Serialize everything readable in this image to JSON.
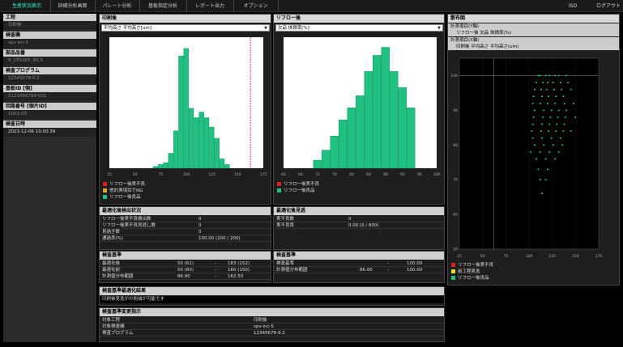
{
  "nav": {
    "tabs": [
      "生産状況表示",
      "詳細分析画面",
      "パレート分析",
      "基板指定分析",
      "レポート出力",
      "オプション"
    ],
    "active_index": 0,
    "user": "ISD",
    "logout": "ログアウト"
  },
  "sidebar": {
    "fields": [
      {
        "label": "工程",
        "value": "印刷後"
      },
      {
        "label": "検査機",
        "value": "spv-inc-5"
      },
      {
        "label": "部品品番",
        "value": "R_CP1005_R0.5"
      },
      {
        "label": "検査プログラム",
        "value": "12345678-9.2"
      },
      {
        "label": "基板ID [個]",
        "value": "0123456789-001"
      },
      {
        "label": "回路番号 [個片ID]",
        "value": "1001-03"
      },
      {
        "label": "検査日時",
        "value": "2023-12-06 10:00:39"
      }
    ]
  },
  "panel_print": {
    "title": "印刷後",
    "dropdown": "平均高さ 平均高さ[um]",
    "legend": [
      "リフロー後実不良",
      "他計測項目でNG",
      "リフロー後良品"
    ],
    "legend_colors": [
      "#e02020",
      "#e0a020",
      "#20c080"
    ],
    "chart_data": {
      "type": "bar",
      "x": [
        70,
        75,
        80,
        85,
        90,
        95,
        100,
        105,
        110,
        115,
        120,
        125,
        130,
        135,
        140
      ],
      "values": [
        1,
        2,
        3,
        8,
        20,
        60,
        64,
        32,
        27,
        30,
        27,
        22,
        16,
        5,
        2
      ],
      "xticks": [
        "25",
        "50",
        "75",
        "100",
        "125",
        "150",
        "175"
      ],
      "xlim": [
        25,
        175
      ],
      "ylim": [
        0,
        70
      ],
      "limit_line": 162.5
    }
  },
  "panel_reflow": {
    "title": "リフロー後",
    "dropdown": "欠品 体積率[%]",
    "legend": [
      "リフロー後実不良",
      "リフロー後良品"
    ],
    "legend_colors": [
      "#e02020",
      "#20c080"
    ],
    "chart_data": {
      "type": "bar",
      "x": [
        72,
        74,
        76,
        78,
        80,
        82,
        84,
        86,
        88,
        90,
        92,
        94
      ],
      "values": [
        4,
        9,
        16,
        24,
        30,
        36,
        48,
        56,
        60,
        48,
        40,
        30
      ],
      "xticks": [
        "64",
        "68",
        "72",
        "76",
        "80",
        "84",
        "88",
        "92",
        "96",
        "100"
      ],
      "xlim": [
        64,
        100
      ],
      "ylim": [
        0,
        65
      ]
    }
  },
  "scatter_panel": {
    "title": "散布図",
    "y_item_label": "計測項目(Y軸)",
    "y_item_value": "リフロー後 欠品 体積率(%)",
    "x_item_label": "計測項目(X軸)",
    "x_item_value": "印刷後 平均高さ 平均高さ(um)",
    "legend": [
      "リフロー後実不良",
      "前工程見逃",
      "リフロー後良品"
    ],
    "legend_colors": [
      "#e02020",
      "#e0e020",
      "#20c080"
    ],
    "chart_data": {
      "type": "scatter",
      "xticks": [
        "25",
        "50",
        "75",
        "100",
        "125",
        "150",
        "175"
      ],
      "yticks": [
        "50",
        "60",
        "70",
        "80",
        "90",
        "100"
      ],
      "xlim": [
        25,
        175
      ],
      "ylim": [
        50,
        105
      ],
      "points": [
        [
          110,
          100
        ],
        [
          112,
          100
        ],
        [
          118,
          100
        ],
        [
          122,
          100
        ],
        [
          128,
          100
        ],
        [
          132,
          100
        ],
        [
          140,
          100
        ],
        [
          108,
          98
        ],
        [
          115,
          98
        ],
        [
          120,
          98
        ],
        [
          126,
          98
        ],
        [
          134,
          98
        ],
        [
          142,
          98
        ],
        [
          106,
          96
        ],
        [
          113,
          96
        ],
        [
          119,
          96
        ],
        [
          127,
          96
        ],
        [
          135,
          96
        ],
        [
          145,
          96
        ],
        [
          105,
          94
        ],
        [
          114,
          94
        ],
        [
          121,
          94
        ],
        [
          129,
          94
        ],
        [
          137,
          94
        ],
        [
          104,
          92
        ],
        [
          112,
          92
        ],
        [
          120,
          92
        ],
        [
          128,
          92
        ],
        [
          138,
          92
        ],
        [
          148,
          92
        ],
        [
          106,
          90
        ],
        [
          116,
          90
        ],
        [
          124,
          90
        ],
        [
          132,
          90
        ],
        [
          140,
          90
        ],
        [
          105,
          88
        ],
        [
          115,
          88
        ],
        [
          123,
          88
        ],
        [
          131,
          88
        ],
        [
          139,
          88
        ],
        [
          150,
          88
        ],
        [
          104,
          86
        ],
        [
          114,
          86
        ],
        [
          122,
          86
        ],
        [
          130,
          86
        ],
        [
          138,
          86
        ],
        [
          103,
          84
        ],
        [
          113,
          84
        ],
        [
          121,
          84
        ],
        [
          129,
          84
        ],
        [
          137,
          84
        ],
        [
          145,
          84
        ],
        [
          104,
          82
        ],
        [
          114,
          82
        ],
        [
          124,
          82
        ],
        [
          134,
          82
        ],
        [
          106,
          80
        ],
        [
          116,
          80
        ],
        [
          126,
          80
        ],
        [
          136,
          80
        ],
        [
          102,
          78
        ],
        [
          112,
          78
        ],
        [
          122,
          78
        ],
        [
          132,
          78
        ],
        [
          108,
          76
        ],
        [
          118,
          76
        ],
        [
          128,
          76
        ],
        [
          110,
          73
        ],
        [
          120,
          73
        ],
        [
          112,
          70
        ],
        [
          118,
          70
        ],
        [
          114,
          66
        ]
      ]
    }
  },
  "stats_opt": {
    "title": "最適化後検出状況",
    "rows": [
      {
        "label": "リフロー後実不良検出数",
        "value": "0"
      },
      {
        "label": "リフロー後実不良見逃し数",
        "value": "0"
      },
      {
        "label": "見過ぎ数",
        "value": "0"
      },
      {
        "label": "通過率(%)",
        "value": "100.00 (200 / 200)"
      }
    ]
  },
  "stats_escape": {
    "title": "最適化後見逃",
    "rows": [
      {
        "label": "実不良数",
        "value": "0"
      },
      {
        "label": "実不良率",
        "value": "0.00 (0 / 800)"
      }
    ]
  },
  "criteria_left": {
    "title": "検査基準",
    "rows": [
      {
        "label": "最適化後",
        "a": "50 (61)",
        "sep": "-",
        "b": "183 (152)"
      },
      {
        "label": "最適化前",
        "a": "50 (60)",
        "sep": "-",
        "b": "160 (150)"
      },
      {
        "label": "計測値分布範囲",
        "a": "86.90",
        "sep": "-",
        "b": "162.50"
      }
    ]
  },
  "criteria_right": {
    "title": "検査基準",
    "rows": [
      {
        "label": "検査基準",
        "a": "",
        "sep": "-",
        "b": "100.00"
      },
      {
        "label": "計測値分布範囲",
        "a": "86.00",
        "sep": "-",
        "b": "100.00"
      }
    ]
  },
  "opt_result": {
    "title": "検査基準最適化結果",
    "message": "印刷後見逃がの削減が可能です"
  },
  "change_list": {
    "title": "検査基準変更指示",
    "rows": [
      {
        "label": "対象工程",
        "value": "印刷後"
      },
      {
        "label": "対象検査機",
        "value": "spv-inc-5"
      },
      {
        "label": "検査プログラム",
        "value": "12345678-9.2"
      }
    ]
  }
}
